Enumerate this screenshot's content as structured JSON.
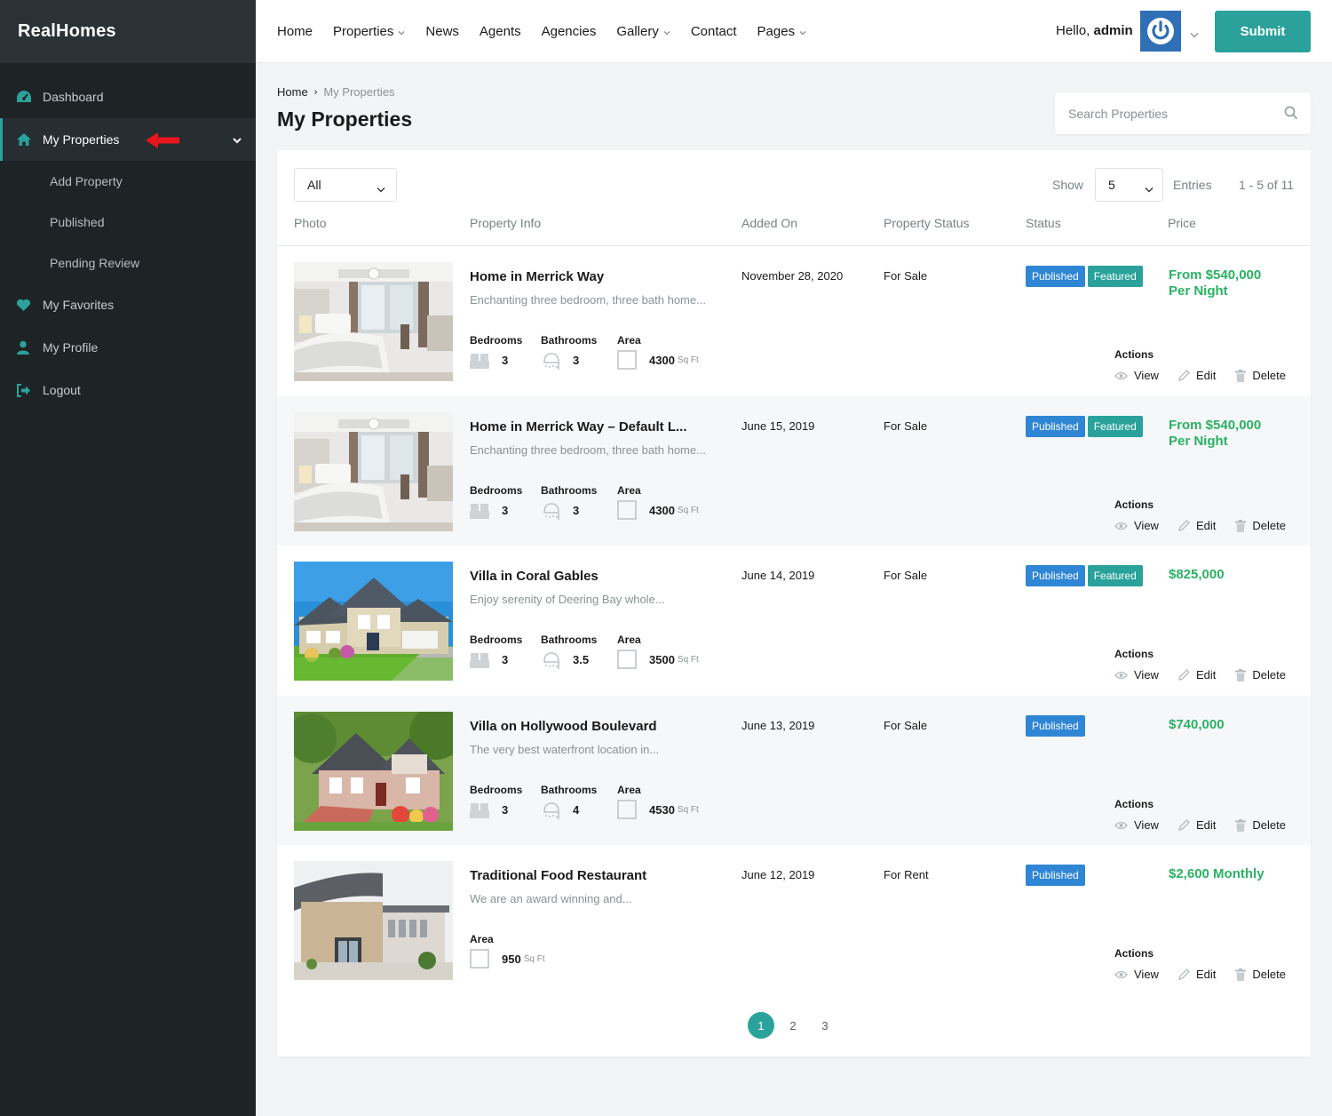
{
  "app": {
    "logo": "RealHomes"
  },
  "sidebar": {
    "items": [
      {
        "label": "Dashboard",
        "icon": "dashboard-icon"
      },
      {
        "label": "My Properties",
        "icon": "home-icon",
        "active": true
      },
      {
        "label": "My Favorites",
        "icon": "heart-icon"
      },
      {
        "label": "My Profile",
        "icon": "user-icon"
      },
      {
        "label": "Logout",
        "icon": "logout-icon"
      }
    ],
    "subitems": [
      "Add Property",
      "Published",
      "Pending Review"
    ]
  },
  "header": {
    "menu": [
      {
        "label": "Home",
        "dropdown": false
      },
      {
        "label": "Properties",
        "dropdown": true
      },
      {
        "label": "News",
        "dropdown": false
      },
      {
        "label": "Agents",
        "dropdown": false
      },
      {
        "label": "Agencies",
        "dropdown": false
      },
      {
        "label": "Gallery",
        "dropdown": true
      },
      {
        "label": "Contact",
        "dropdown": false
      },
      {
        "label": "Pages",
        "dropdown": true
      }
    ],
    "greeting": "Hello,",
    "username": "admin",
    "submit_label": "Submit"
  },
  "page": {
    "breadcrumb_home": "Home",
    "breadcrumb_current": "My Properties",
    "title": "My Properties",
    "search_placeholder": "Search Properties"
  },
  "toolbar": {
    "filter_value": "All",
    "show_label": "Show",
    "show_value": "5",
    "entries_label": "Entries",
    "range": "1 - 5 of 11"
  },
  "columns": [
    "Photo",
    "Property Info",
    "Added On",
    "Property Status",
    "Status",
    "Price"
  ],
  "labels": {
    "bedrooms": "Bedrooms",
    "bathrooms": "Bathrooms",
    "area": "Area",
    "area_unit": "Sq Ft",
    "actions": "Actions",
    "view": "View",
    "edit": "Edit",
    "delete": "Delete",
    "published": "Published",
    "featured": "Featured"
  },
  "properties": [
    {
      "title": "Home in Merrick Way",
      "desc": "Enchanting three bedroom, three bath home...",
      "bedrooms": "3",
      "bathrooms": "3",
      "area": "4300",
      "added": "November 28, 2020",
      "property_status": "For Sale",
      "published": true,
      "featured": true,
      "price": "From $540,000",
      "price_suffix": "Per Night",
      "photo": "bedroom"
    },
    {
      "title": "Home in Merrick Way – Default L...",
      "desc": "Enchanting three bedroom, three bath home...",
      "bedrooms": "3",
      "bathrooms": "3",
      "area": "4300",
      "added": "June 15, 2019",
      "property_status": "For Sale",
      "published": true,
      "featured": true,
      "price": "From $540,000",
      "price_suffix": "Per Night",
      "photo": "bedroom"
    },
    {
      "title": "Villa in Coral Gables",
      "desc": "Enjoy serenity of Deering Bay whole...",
      "bedrooms": "3",
      "bathrooms": "3.5",
      "area": "3500",
      "added": "June 14, 2019",
      "property_status": "For Sale",
      "published": true,
      "featured": true,
      "price": "$825,000",
      "price_suffix": "",
      "photo": "villa"
    },
    {
      "title": "Villa on Hollywood Boulevard",
      "desc": "The very best waterfront location in...",
      "bedrooms": "3",
      "bathrooms": "4",
      "area": "4530",
      "added": "June 13, 2019",
      "property_status": "For Sale",
      "published": true,
      "featured": false,
      "price": "$740,000",
      "price_suffix": "",
      "photo": "cottage"
    },
    {
      "title": "Traditional Food Restaurant",
      "desc": "We are an award winning and...",
      "bedrooms": "",
      "bathrooms": "",
      "area": "950",
      "added": "June 12, 2019",
      "property_status": "For Rent",
      "published": true,
      "featured": false,
      "price": "$2,600 Monthly",
      "price_suffix": "",
      "photo": "restaurant"
    }
  ],
  "pagination": {
    "pages": [
      "1",
      "2",
      "3"
    ],
    "current": "1"
  },
  "colors": {
    "accent": "#2aa29b",
    "published": "#2f86d4",
    "price": "#2bb164",
    "sidebar": "#1e2326"
  }
}
